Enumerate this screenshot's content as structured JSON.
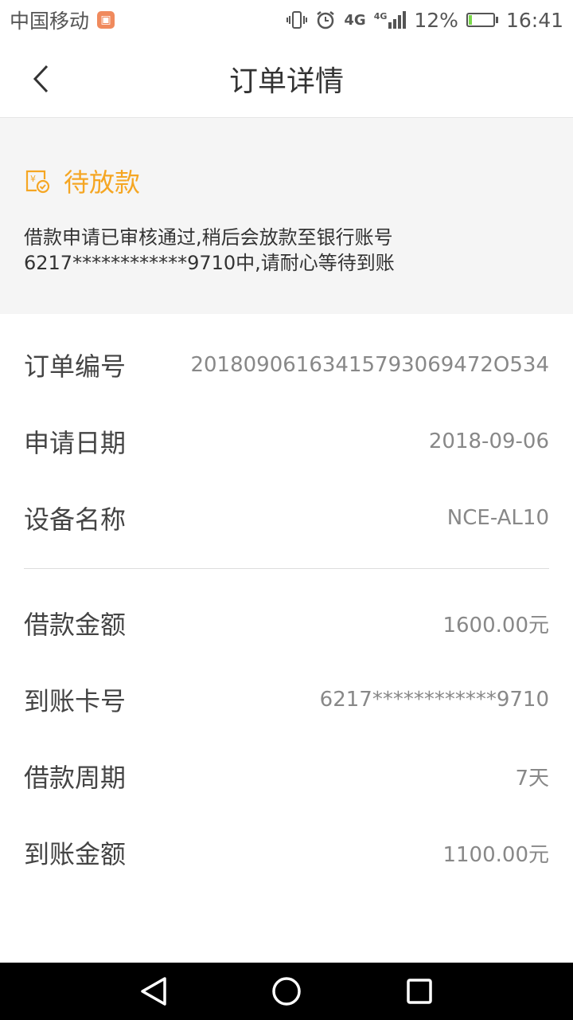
{
  "status_bar": {
    "carrier": "中国移动",
    "network": "4G",
    "network_small": "4G",
    "battery_percent": "12%",
    "battery_level": 0.12,
    "time": "16:41"
  },
  "header": {
    "title": "订单详情"
  },
  "order_status": {
    "title": "待放款",
    "description": "借款申请已审核通过,稍后会放款至银行账号6217************9710中,请耐心等待到账",
    "accent_color": "#f5a623"
  },
  "details_group1": [
    {
      "label": "订单编号",
      "value": "20180906163415793069472O534"
    },
    {
      "label": "申请日期",
      "value": "2018-09-06"
    },
    {
      "label": "设备名称",
      "value": "NCE-AL10"
    }
  ],
  "details_group2": [
    {
      "label": "借款金额",
      "value": "1600.00元"
    },
    {
      "label": "到账卡号",
      "value": "6217************9710"
    },
    {
      "label": "借款周期",
      "value": "7天"
    },
    {
      "label": "到账金额",
      "value": "1100.00元"
    }
  ]
}
